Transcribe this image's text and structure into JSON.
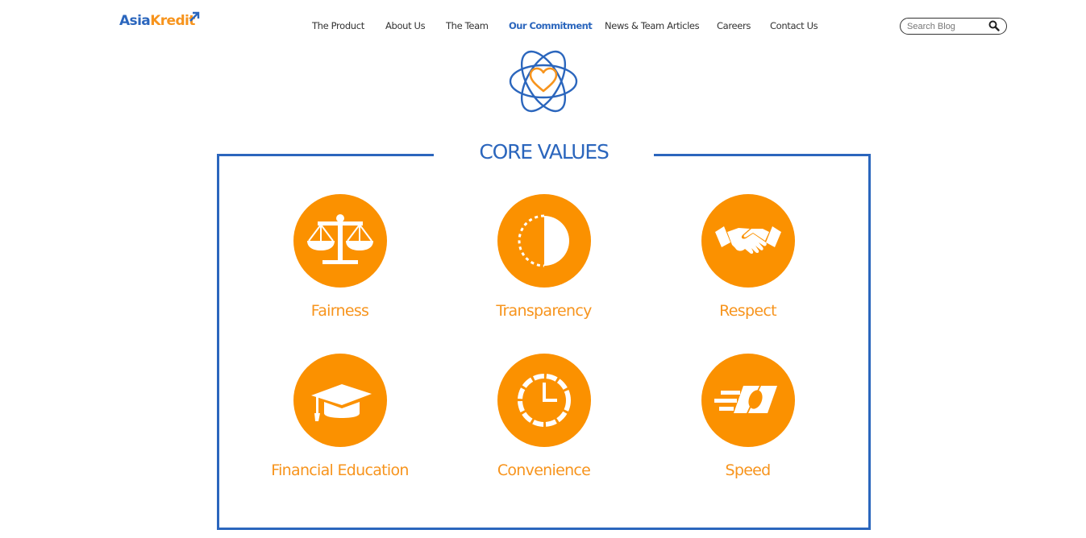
{
  "header": {
    "logo": {
      "part1": "Asia",
      "part2": "Kredit"
    },
    "nav": [
      {
        "label": "The Product"
      },
      {
        "label": "About Us"
      },
      {
        "label": "The Team"
      },
      {
        "label": "Our Commitment",
        "active": true
      },
      {
        "label": "News & Team Articles"
      },
      {
        "label": "Careers"
      },
      {
        "label": "Contact Us"
      }
    ],
    "search": {
      "placeholder": "Search Blog",
      "value": ""
    }
  },
  "core_values": {
    "title": "CORE VALUES",
    "items": [
      {
        "label": "Fairness",
        "icon": "scales-icon"
      },
      {
        "label": "Transparency",
        "icon": "half-circle-icon"
      },
      {
        "label": "Respect",
        "icon": "handshake-icon"
      },
      {
        "label": "Financial Education",
        "icon": "graduation-cap-icon"
      },
      {
        "label": "Convenience",
        "icon": "clock-icon"
      },
      {
        "label": "Speed",
        "icon": "fast-money-icon"
      }
    ]
  },
  "colors": {
    "brand_blue": "#2b66bd",
    "accent_orange": "#f7941d",
    "circle_orange": "#fb9100"
  }
}
